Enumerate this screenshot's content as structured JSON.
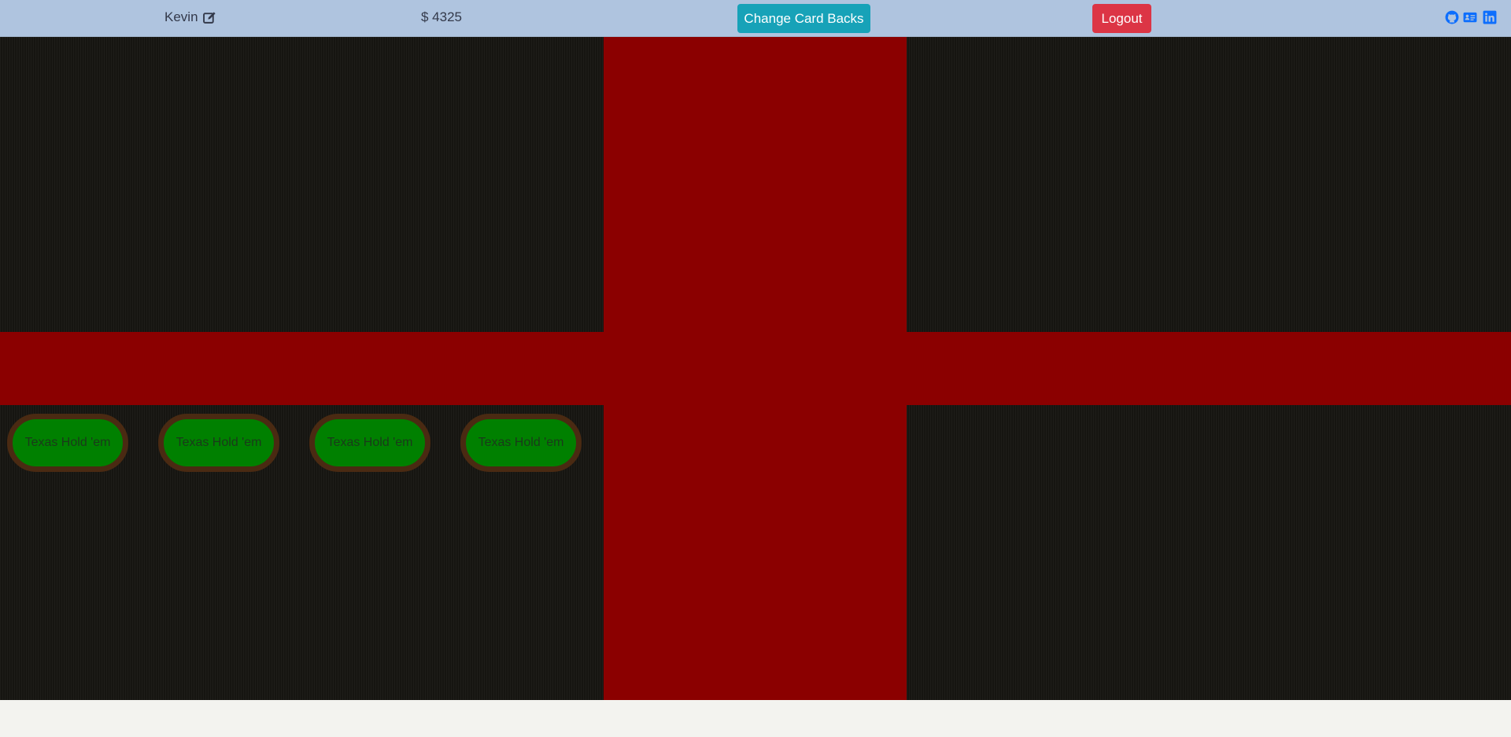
{
  "header": {
    "username": "Kevin",
    "balance": "$ 4325",
    "change_card_backs_label": "Change Card Backs",
    "logout_label": "Logout",
    "icons": [
      "edit-icon",
      "github-icon",
      "contact-card-icon",
      "linkedin-icon"
    ]
  },
  "games": {
    "tables": [
      {
        "label": "Texas Hold 'em"
      },
      {
        "label": "Texas Hold 'em"
      },
      {
        "label": "Texas Hold 'em"
      },
      {
        "label": "Texas Hold 'em"
      }
    ]
  },
  "colors": {
    "navbar": "#afc4df",
    "change_card_backs": "#17a2b8",
    "logout": "#dc3545",
    "social_icons": "#0d6efd",
    "red_band": "#8b0000",
    "table_felt": "#008000",
    "table_rim": "#4a2a12",
    "background": "#161511"
  }
}
